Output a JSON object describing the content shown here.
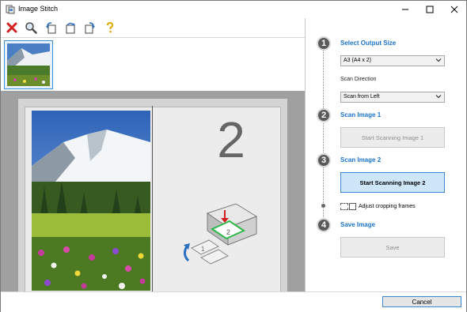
{
  "window": {
    "title": "Image Stitch"
  },
  "toolbar": {
    "buttons": [
      {
        "name": "delete",
        "icon": "red-x-icon"
      },
      {
        "name": "zoom",
        "icon": "magnifier-icon"
      },
      {
        "name": "rotate-left",
        "icon": "rotate-left-icon"
      },
      {
        "name": "rotate-180",
        "icon": "rotate-180-icon"
      },
      {
        "name": "rotate-right",
        "icon": "rotate-right-icon"
      },
      {
        "name": "help",
        "icon": "question-icon"
      }
    ]
  },
  "preview": {
    "placeholder_number": "2"
  },
  "steps": [
    {
      "number": "1",
      "label": "Select Output Size"
    },
    {
      "number": "2",
      "label": "Scan Image 1"
    },
    {
      "number": "3",
      "label": "Scan Image 2"
    },
    {
      "number": "4",
      "label": "Save Image"
    }
  ],
  "output_size": {
    "selected": "A3 (A4 x 2)"
  },
  "scan_direction": {
    "label": "Scan Direction",
    "selected": "Scan from Left"
  },
  "buttons": {
    "scan1": "Start Scanning Image 1",
    "scan2": "Start Scanning Image 2",
    "save": "Save",
    "cancel": "Cancel"
  },
  "adjust_cropping": {
    "label": "Adjust cropping frames",
    "checked": false
  },
  "colors": {
    "accent": "#1a73c8",
    "primary_button_bg": "#cde6fa",
    "preview_bg": "#a0a0a0"
  }
}
